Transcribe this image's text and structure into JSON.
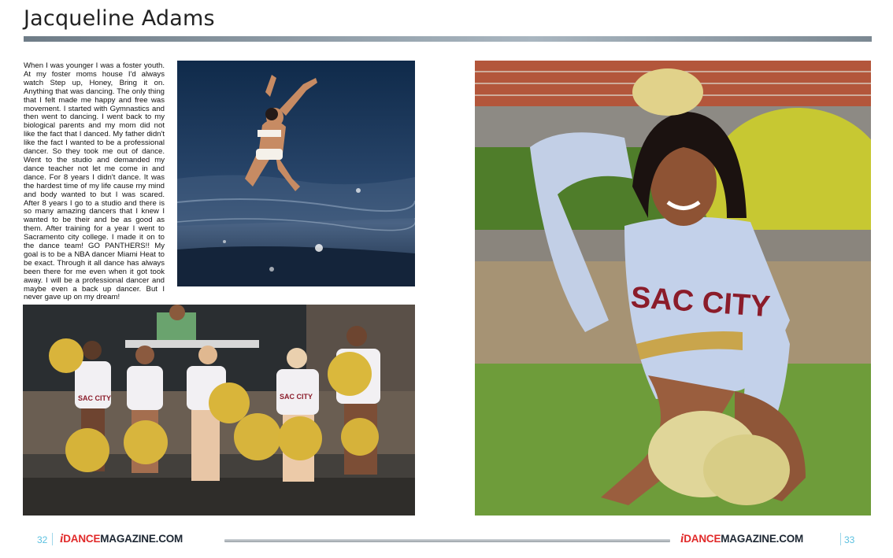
{
  "header": {
    "title": "Jacqueline Adams"
  },
  "story": {
    "text": "When I was younger I was a foster youth. At my foster moms house I'd always watch Step up, Honey, Bring it on. Anything that was dancing. The only thing that I felt made me happy and free was movement. I started with Gymnastics and then went to dancing. I went back to my biological parents and my mom did not like the fact that I danced. My father didn't like the fact I wanted to be a professional dancer. So they took me out of dance. Went to the studio and demanded my dance teacher not let me come in and dance. For 8 years I didn't dance. It was the hardest time of my life cause my mind and body wanted to but I was scared. After 8 years I go to a studio and there is so many amazing dancers that I knew I wanted to be their and be as good as them. After training for a year I went to Sacramento city college. I made it on to the dance team! GO PANTHERS!! My goal is to be a NBA dancer Miami Heat to be exact. Through it all dance has always been there for me even when it got took away. I will be a professional dancer and maybe even a back up dancer. But I never gave up on my dream!"
  },
  "photos": {
    "portrait_jersey_text": "SAC CITY",
    "team_jersey_text": "SAC CITY"
  },
  "footer": {
    "left_page": "32",
    "right_page": "33",
    "logo_i": "i",
    "logo_dance": "DANCE",
    "logo_mag": "MAGAZINE.COM"
  },
  "colors": {
    "accent_red": "#e12a2a",
    "page_number_blue": "#5cc1e0",
    "rule_gray": "#8b98a2"
  }
}
